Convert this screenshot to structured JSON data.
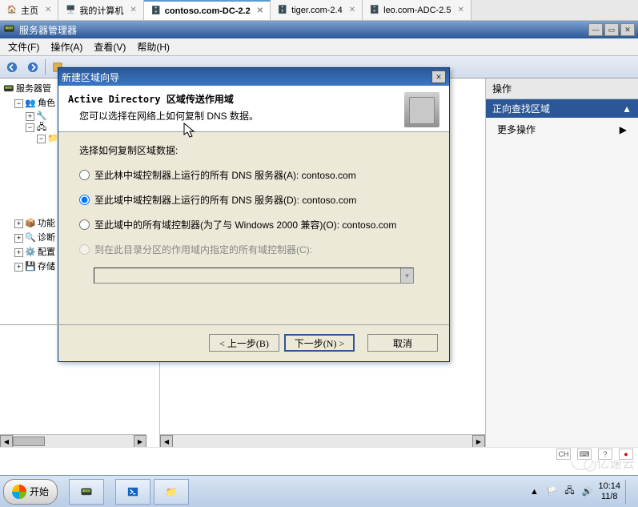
{
  "tabs": {
    "home": "主页",
    "mycomputer": "我的计算机",
    "active": "contoso.com-DC-2.2",
    "t4": "tiger.com-2.4",
    "t5": "leo.com-ADC-2.5"
  },
  "app": {
    "title": "服务器管理器"
  },
  "menu": {
    "file": "文件(F)",
    "action": "操作(A)",
    "view": "查看(V)",
    "help": "帮助(H)"
  },
  "tree": {
    "root": "服务器管",
    "roles": "角色",
    "features": "功能",
    "diagnostics": "诊断",
    "configuration": "配置",
    "storage": "存储"
  },
  "actions": {
    "header": "操作",
    "subheader": "正向查找区域",
    "more": "更多操作"
  },
  "wizard": {
    "title": "新建区域向导",
    "header_title": "Active Directory 区域传送作用域",
    "header_sub": "您可以选择在网络上如何复制 DNS 数据。",
    "prompt": "选择如何复制区域数据:",
    "opt_forest": "至此林中域控制器上运行的所有 DNS 服务器(A): contoso.com",
    "opt_domain": "至此域中域控制器上运行的所有 DNS 服务器(D): contoso.com",
    "opt_all_dc": "至此域中的所有域控制器(为了与 Windows 2000 兼容)(O): contoso.com",
    "opt_partition": "到在此目录分区的作用域内指定的所有域控制器(C):",
    "back": "< 上一步(B)",
    "next": "下一步(N) >",
    "cancel": "取消"
  },
  "status": {
    "lang": "CH"
  },
  "taskbar": {
    "start": "开始",
    "time": "10:14",
    "date": "11/8"
  },
  "watermark": "亿速云"
}
